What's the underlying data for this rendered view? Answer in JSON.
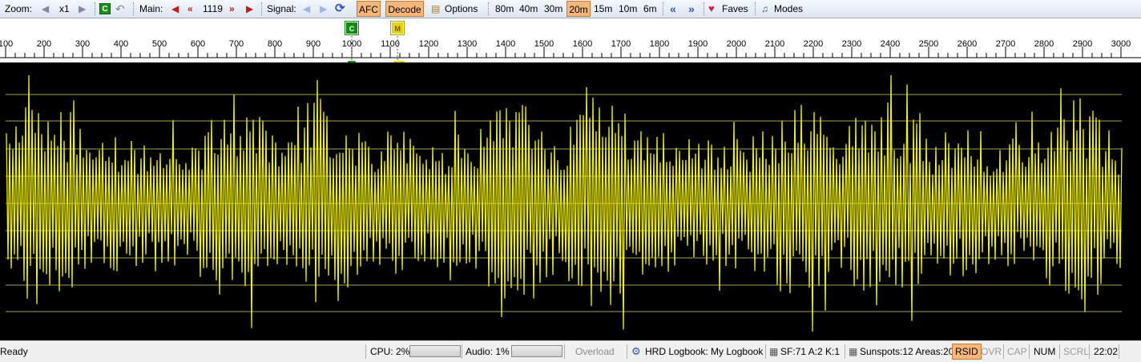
{
  "toolbar": {
    "zoom_label": "Zoom:",
    "zoom_value": "x1",
    "c_button": "C",
    "main_label": "Main:",
    "main_value": "1119",
    "signal_label": "Signal:",
    "afc": "AFC",
    "decode": "Decode",
    "options": "Options",
    "bands": [
      "80m",
      "40m",
      "30m",
      "20m",
      "15m",
      "10m",
      "6m"
    ],
    "active_band": "20m",
    "faves": "Faves",
    "modes": "Modes"
  },
  "ruler": {
    "labels": [
      "100",
      "200",
      "300",
      "400",
      "500",
      "600",
      "700",
      "800",
      "900",
      "1000",
      "1100",
      "1200",
      "1300",
      "1400",
      "1500",
      "1600",
      "1700",
      "1800",
      "1900",
      "2000",
      "2100",
      "2200",
      "2300",
      "2400",
      "2500",
      "2600",
      "2700",
      "2800",
      "2900",
      "3000"
    ],
    "range": [
      100,
      3000
    ],
    "marker_c": {
      "label": "C",
      "freq": 1000
    },
    "marker_m": {
      "label": "M",
      "freq": 1119
    }
  },
  "status": {
    "ready": "Ready",
    "cpu": "CPU: 2%",
    "audio": "Audio: 1%",
    "overload": "Overload",
    "logbook": "HRD Logbook: My Logbook",
    "sf": "SF:71 A:2 K:1",
    "sunspots": "Sunspots:12 Areas:20",
    "rsid": "RSID",
    "ovr": "OVR",
    "cap": "CAP",
    "num": "NUM",
    "scrl": "SCRL",
    "time": "22:02"
  },
  "colors": {
    "waveform": "#f2f200",
    "grid": "#c8c864",
    "accent": "#f7b77b"
  }
}
